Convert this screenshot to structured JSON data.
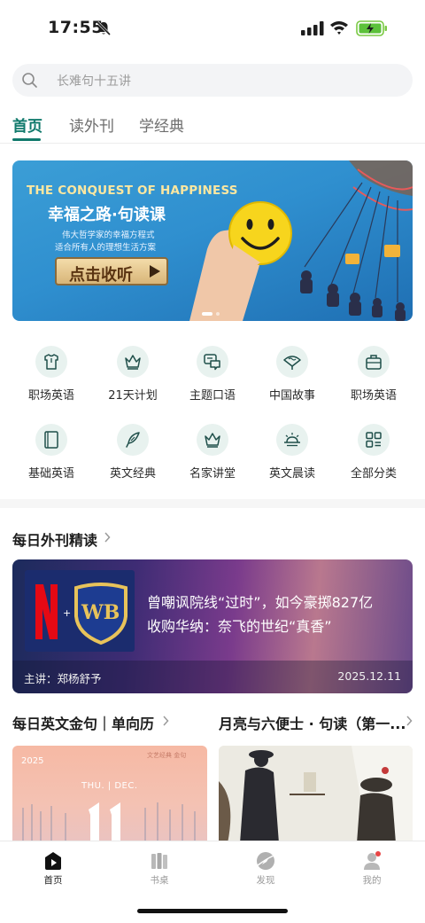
{
  "status_bar": {
    "time": "17:55"
  },
  "search": {
    "placeholder": "长难句十五讲"
  },
  "tabs": [
    {
      "label": "首页",
      "active": true
    },
    {
      "label": "读外刊",
      "active": false
    },
    {
      "label": "学经典",
      "active": false
    }
  ],
  "banner": {
    "title_en": "THE CONQUEST OF HAPPINESS",
    "title_cn": "幸福之路·句读课",
    "subtitle1": "伟大哲学家的幸福方程式",
    "subtitle2": "适合所有人的理想生活方案",
    "button_label": "点击收听",
    "pages": 2,
    "active_page": 1
  },
  "categories": [
    {
      "label": "职场英语",
      "icon": "shirt-icon"
    },
    {
      "label": "21天计划",
      "icon": "crown-icon"
    },
    {
      "label": "主题口语",
      "icon": "chat-icon"
    },
    {
      "label": "中国故事",
      "icon": "fan-icon"
    },
    {
      "label": "职场英语",
      "icon": "briefcase-icon"
    },
    {
      "label": "基础英语",
      "icon": "book-icon"
    },
    {
      "label": "英文经典",
      "icon": "feather-icon"
    },
    {
      "label": "名家讲堂",
      "icon": "crown-icon"
    },
    {
      "label": "英文晨读",
      "icon": "sunrise-icon"
    },
    {
      "label": "全部分类",
      "icon": "grid-icon"
    }
  ],
  "daily_reading": {
    "section_title": "每日外刊精读",
    "article": {
      "logo_text": "WB",
      "title_line1": "曾嘲讽院线“过时”，如今豪掷827亿",
      "title_line2": "收购华纳：奈飞的世纪“真香”",
      "speaker": "主讲：郑杨舒予",
      "date": "2025.12.11"
    }
  },
  "bottom_sections": {
    "left_title": "每日英文金句｜单向历",
    "right_title": "月亮与六便士 · 句读（第一...",
    "left_card": {
      "year": "2025",
      "tag": "文艺经典  金句",
      "month": "THU.  |  DEC."
    }
  },
  "tabbar": [
    {
      "label": "首页",
      "icon": "play-home-icon",
      "active": true
    },
    {
      "label": "书桌",
      "icon": "books-icon",
      "active": false
    },
    {
      "label": "发现",
      "icon": "compass-icon",
      "active": false
    },
    {
      "label": "我的",
      "icon": "profile-icon",
      "active": false
    }
  ],
  "colors": {
    "accent": "#117a6c",
    "icon_bg": "#e8f2ef"
  }
}
